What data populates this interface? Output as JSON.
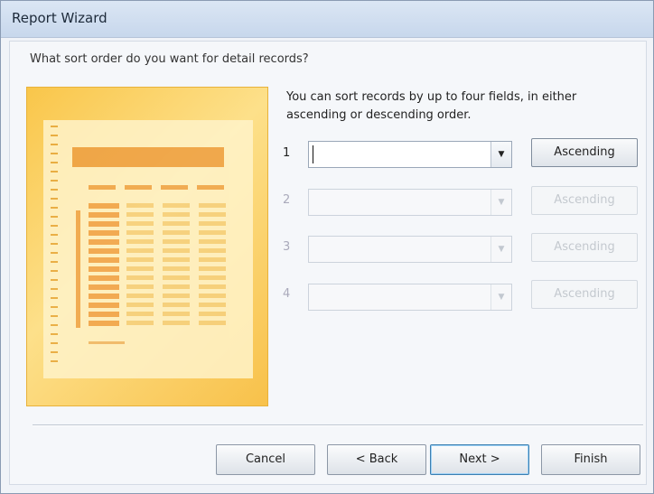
{
  "window": {
    "title": "Report Wizard"
  },
  "question": "What sort order do you want for detail records?",
  "instructions": "You can sort records by up to four fields, in either ascending or descending order.",
  "sort_fields": [
    {
      "number": "1",
      "value": "",
      "order_label": "Ascending",
      "enabled": true
    },
    {
      "number": "2",
      "value": "",
      "order_label": "Ascending",
      "enabled": false
    },
    {
      "number": "3",
      "value": "",
      "order_label": "Ascending",
      "enabled": false
    },
    {
      "number": "4",
      "value": "",
      "order_label": "Ascending",
      "enabled": false
    }
  ],
  "buttons": {
    "cancel": "Cancel",
    "back": "< Back",
    "next": "Next >",
    "finish": "Finish"
  },
  "icons": {
    "dropdown": "chevron-down-icon"
  }
}
